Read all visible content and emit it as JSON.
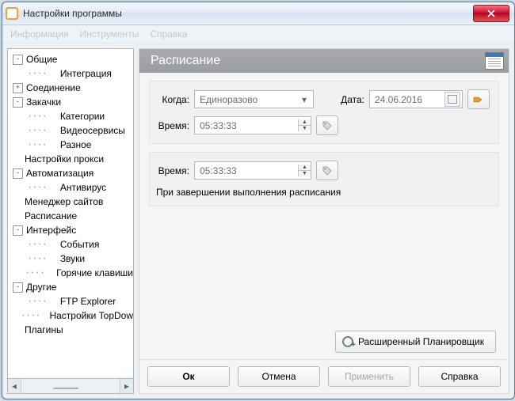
{
  "window": {
    "title": "Настройки программы"
  },
  "menu_ghost": [
    "Информация",
    "Инструменты",
    "Справка"
  ],
  "tree": [
    {
      "depth": 0,
      "exp": "-",
      "label": "Общие"
    },
    {
      "depth": 1,
      "exp": "",
      "label": "Интеграция"
    },
    {
      "depth": 0,
      "exp": "+",
      "label": "Соединение"
    },
    {
      "depth": 0,
      "exp": "-",
      "label": "Закачки"
    },
    {
      "depth": 1,
      "exp": "",
      "label": "Категории"
    },
    {
      "depth": 1,
      "exp": "",
      "label": "Видеосервисы"
    },
    {
      "depth": 1,
      "exp": "",
      "label": "Разное"
    },
    {
      "depth": 0,
      "exp": "",
      "label": "Настройки прокси"
    },
    {
      "depth": 0,
      "exp": "-",
      "label": "Автоматизация"
    },
    {
      "depth": 1,
      "exp": "",
      "label": "Антивирус"
    },
    {
      "depth": 0,
      "exp": "",
      "label": "Менеджер сайтов"
    },
    {
      "depth": 0,
      "exp": "",
      "label": "Расписание"
    },
    {
      "depth": 0,
      "exp": "-",
      "label": "Интерфейс"
    },
    {
      "depth": 1,
      "exp": "",
      "label": "События"
    },
    {
      "depth": 1,
      "exp": "",
      "label": "Звуки"
    },
    {
      "depth": 1,
      "exp": "",
      "label": "Горячие клавиши"
    },
    {
      "depth": 0,
      "exp": "-",
      "label": "Другие"
    },
    {
      "depth": 1,
      "exp": "",
      "label": "FTP Explorer"
    },
    {
      "depth": 1,
      "exp": "",
      "label": "Настройки TopDow"
    },
    {
      "depth": 0,
      "exp": "",
      "label": "Плагины"
    }
  ],
  "section_title": "Расписание",
  "labels": {
    "when": "Когда:",
    "date": "Дата:",
    "time": "Время:"
  },
  "fields": {
    "when_value": "Единоразово",
    "date_value": "24.06.2016",
    "time1": "05:33:33",
    "time2": "05:33:33"
  },
  "on_complete": "При завершении выполнения расписания",
  "advanced_btn": "Расширенный Планировщик",
  "buttons": {
    "ok": "Ок",
    "cancel": "Отмена",
    "apply": "Применить",
    "help": "Справка"
  }
}
